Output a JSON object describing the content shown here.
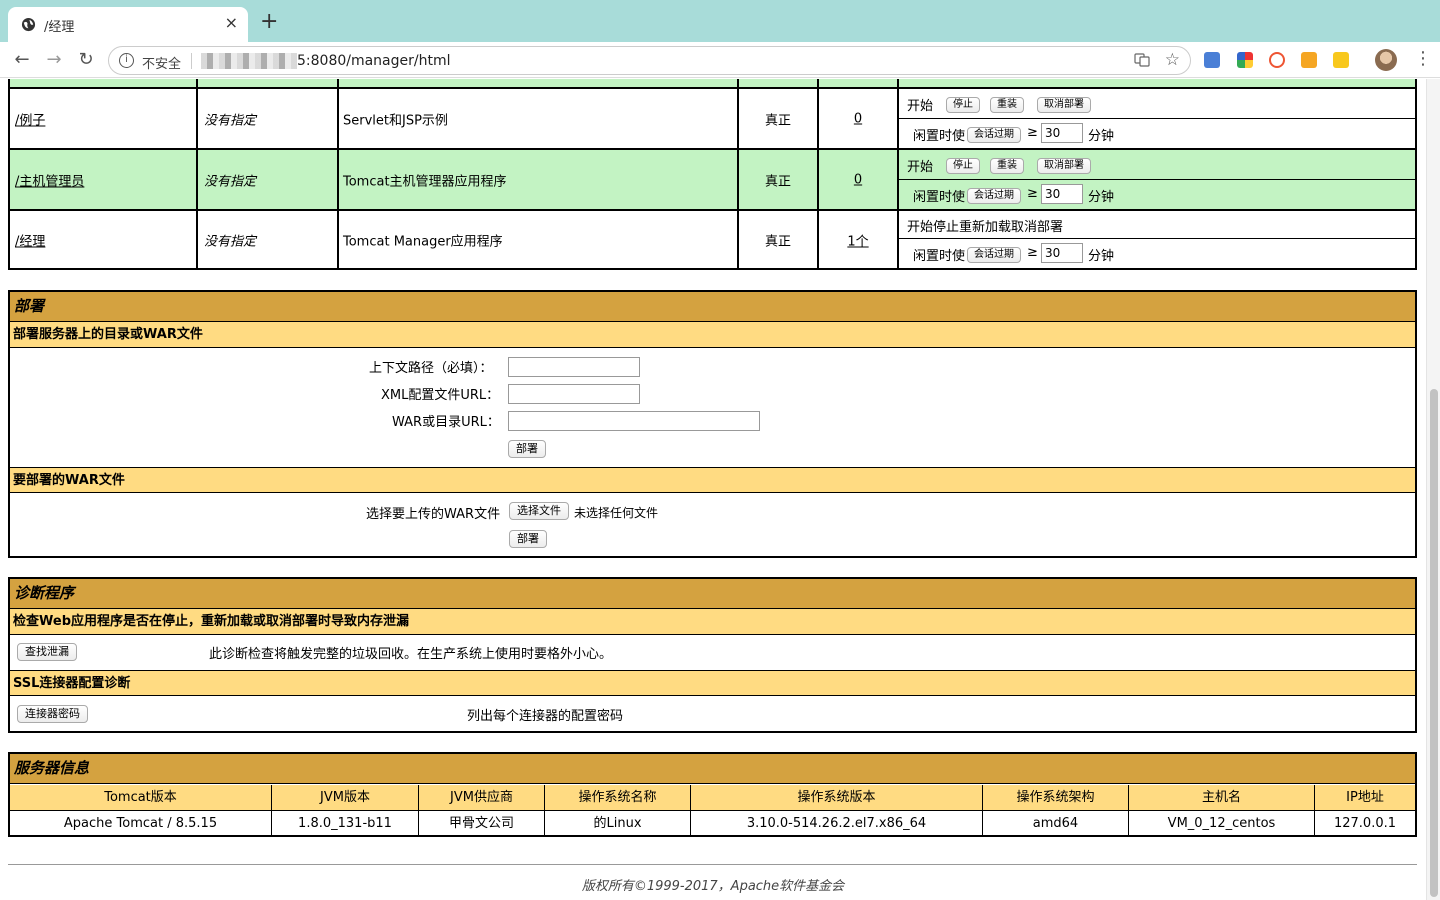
{
  "browser": {
    "tab_title": "/经理",
    "tab_close": "×",
    "new_tab": "+",
    "insecure_label": "不安全",
    "url": "5:8080/manager/html"
  },
  "apps": {
    "rows": [
      {
        "path": "/例子",
        "version": "没有指定",
        "display_name": "Servlet和JSP示例",
        "running": "真正",
        "sessions": "0",
        "green": false,
        "commands_text": "开始",
        "buttons": [
          "停止",
          "重装",
          "取消部署"
        ]
      },
      {
        "path": "/主机管理员",
        "version": "没有指定",
        "display_name": "Tomcat主机管理器应用程序",
        "running": "真正",
        "sessions": "0",
        "green": true,
        "commands_text": "开始",
        "buttons": [
          "停止",
          "重装",
          "取消部署"
        ]
      },
      {
        "path": "/经理",
        "version": "没有指定",
        "display_name": "Tomcat Manager应用程序",
        "running": "真正",
        "sessions": "1个",
        "green": false,
        "commands_text": "开始停止重新加载取消部署",
        "buttons": []
      }
    ],
    "expire_label": "闲置时使",
    "expire_button": "会话过期",
    "expire_op": "≥",
    "expire_value": "30",
    "expire_unit": "分钟"
  },
  "deploy": {
    "title": "部署",
    "server_dir_title": "部署服务器上的目录或WAR文件",
    "context_path_label": "上下文路径（必填）：",
    "xml_config_label": "XML配置文件URL：",
    "war_dir_label": "WAR或目录URL：",
    "deploy_button": "部署",
    "war_upload_title": "要部署的WAR文件",
    "choose_war_label": "选择要上传的WAR文件",
    "choose_file_button": "选择文件",
    "no_file_chosen": "未选择任何文件",
    "deploy_button2": "部署"
  },
  "diagnostics": {
    "title": "诊断程序",
    "leak_title": "检查Web应用程序是否在停止，重新加载或取消部署时导致内存泄漏",
    "find_leaks_button": "查找泄漏",
    "find_leaks_note": "此诊断检查将触发完整的垃圾回收。在生产系统上使用时要格外小心。",
    "ssl_title": "SSL连接器配置诊断",
    "ciphers_button": "连接器密码",
    "ciphers_note": "列出每个连接器的配置密码"
  },
  "server_info": {
    "title": "服务器信息",
    "headers": [
      "Tomcat版本",
      "JVM版本",
      "JVM供应商",
      "操作系统名称",
      "操作系统版本",
      "操作系统架构",
      "主机名",
      "IP地址"
    ],
    "values": [
      "Apache Tomcat / 8.5.15",
      "1.8.0_131-b11",
      "甲骨文公司",
      "的Linux",
      "3.10.0-514.26.2.el7.x86_64",
      "amd64",
      "VM_0_12_centos",
      "127.0.0.1"
    ]
  },
  "footer": "版权所有©1999-2017，Apache软件基金会"
}
